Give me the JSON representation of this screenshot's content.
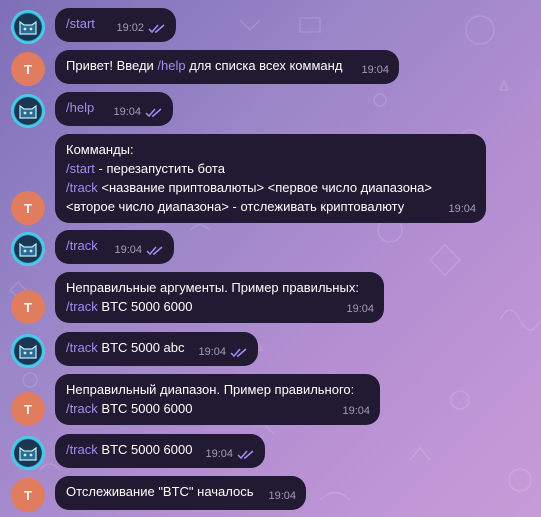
{
  "messages": [
    {
      "from": "me",
      "cmd": "/start",
      "text": "",
      "time": "19:02"
    },
    {
      "from": "bot",
      "avatar": "T",
      "prefix": "Привет! Введи ",
      "cmd": "/help",
      "suffix": " для списка всех комманд",
      "time": "19:04"
    },
    {
      "from": "me",
      "cmd": "/help",
      "text": "",
      "time": "19:04"
    },
    {
      "from": "bot",
      "avatar": "T",
      "lines": [
        {
          "cmd": "",
          "text": "Комманды:"
        },
        {
          "cmd": "/start",
          "text": " - перезапустить бота"
        },
        {
          "cmd": "/track",
          "text": " <название приптовалюты> <первое число диапазона>"
        },
        {
          "cmd": "",
          "text": "<второе число диапазона> - отслеживать криптовалюту"
        }
      ],
      "time": "19:04"
    },
    {
      "from": "me",
      "cmd": "/track",
      "text": "",
      "time": "19:04"
    },
    {
      "from": "bot",
      "avatar": "T",
      "lines": [
        {
          "cmd": "",
          "text": "Неправильные аргументы. Пример правильных:"
        },
        {
          "cmd": "/track",
          "text": " BTC 5000 6000"
        }
      ],
      "time": "19:04"
    },
    {
      "from": "me",
      "cmd": "/track",
      "text": " BTC 5000 abc",
      "time": "19:04"
    },
    {
      "from": "bot",
      "avatar": "T",
      "lines": [
        {
          "cmd": "",
          "text": "Неправильный диапазон. Пример правильного:"
        },
        {
          "cmd": "/track",
          "text": " BTC 5000 6000"
        }
      ],
      "time": "19:04"
    },
    {
      "from": "me",
      "cmd": "/track",
      "text": " BTC 5000 6000",
      "time": "19:04"
    },
    {
      "from": "bot",
      "avatar": "T",
      "text": "Отслеживание \"BTC\" началось",
      "time": "19:04"
    }
  ],
  "colors": {
    "bubble": "#221a33",
    "command": "#9f8ef0",
    "timestamp": "#a49cb4",
    "bot_avatar": "#e27c5f",
    "me_avatar_ring": "#3fc6e8"
  },
  "icons": {
    "read_receipt": "double-check-icon",
    "user_avatar": "cat-avatar-icon"
  }
}
